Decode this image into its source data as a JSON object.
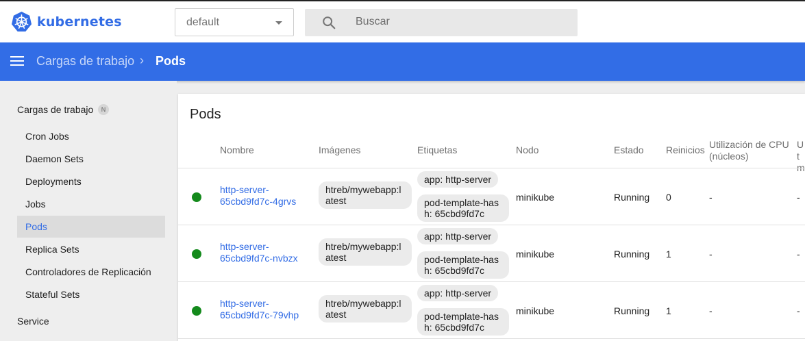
{
  "brand": {
    "name": "kubernetes"
  },
  "namespace": {
    "value": "default"
  },
  "search": {
    "placeholder": "Buscar"
  },
  "breadcrumb": {
    "parent": "Cargas de trabajo",
    "separator": "›",
    "current": "Pods"
  },
  "sidebar": {
    "section_title": "Cargas de trabajo",
    "section_badge": "N",
    "items": [
      {
        "label": "Cron Jobs"
      },
      {
        "label": "Daemon Sets"
      },
      {
        "label": "Deployments"
      },
      {
        "label": "Jobs"
      },
      {
        "label": "Pods"
      },
      {
        "label": "Replica Sets"
      },
      {
        "label": "Controladores de Replicación"
      },
      {
        "label": "Stateful Sets"
      }
    ],
    "next_section": "Service"
  },
  "panel": {
    "title": "Pods",
    "columns": [
      "Nombre",
      "Imágenes",
      "Etiquetas",
      "Nodo",
      "Estado",
      "Reinicios",
      "Utilización de CPU (núcleos)",
      "Ut m"
    ],
    "rows": [
      {
        "name": "http-server-65cbd9fd7c-4grvs",
        "image": "htreb/mywebapp:latest",
        "labels": [
          "app: http-server",
          "pod-template-hash: 65cbd9fd7c"
        ],
        "node": "minikube",
        "status": "Running",
        "restarts": "0",
        "cpu": "-",
        "mem": "-"
      },
      {
        "name": "http-server-65cbd9fd7c-nvbzx",
        "image": "htreb/mywebapp:latest",
        "labels": [
          "app: http-server",
          "pod-template-hash: 65cbd9fd7c"
        ],
        "node": "minikube",
        "status": "Running",
        "restarts": "1",
        "cpu": "-",
        "mem": "-"
      },
      {
        "name": "http-server-65cbd9fd7c-79vhp",
        "image": "htreb/mywebapp:latest",
        "labels": [
          "app: http-server",
          "pod-template-hash: 65cbd9fd7c"
        ],
        "node": "minikube",
        "status": "Running",
        "restarts": "1",
        "cpu": "-",
        "mem": "-"
      }
    ]
  },
  "colors": {
    "accent": "#326ce5",
    "status_ok": "#148a1c",
    "header": "#326de6"
  }
}
